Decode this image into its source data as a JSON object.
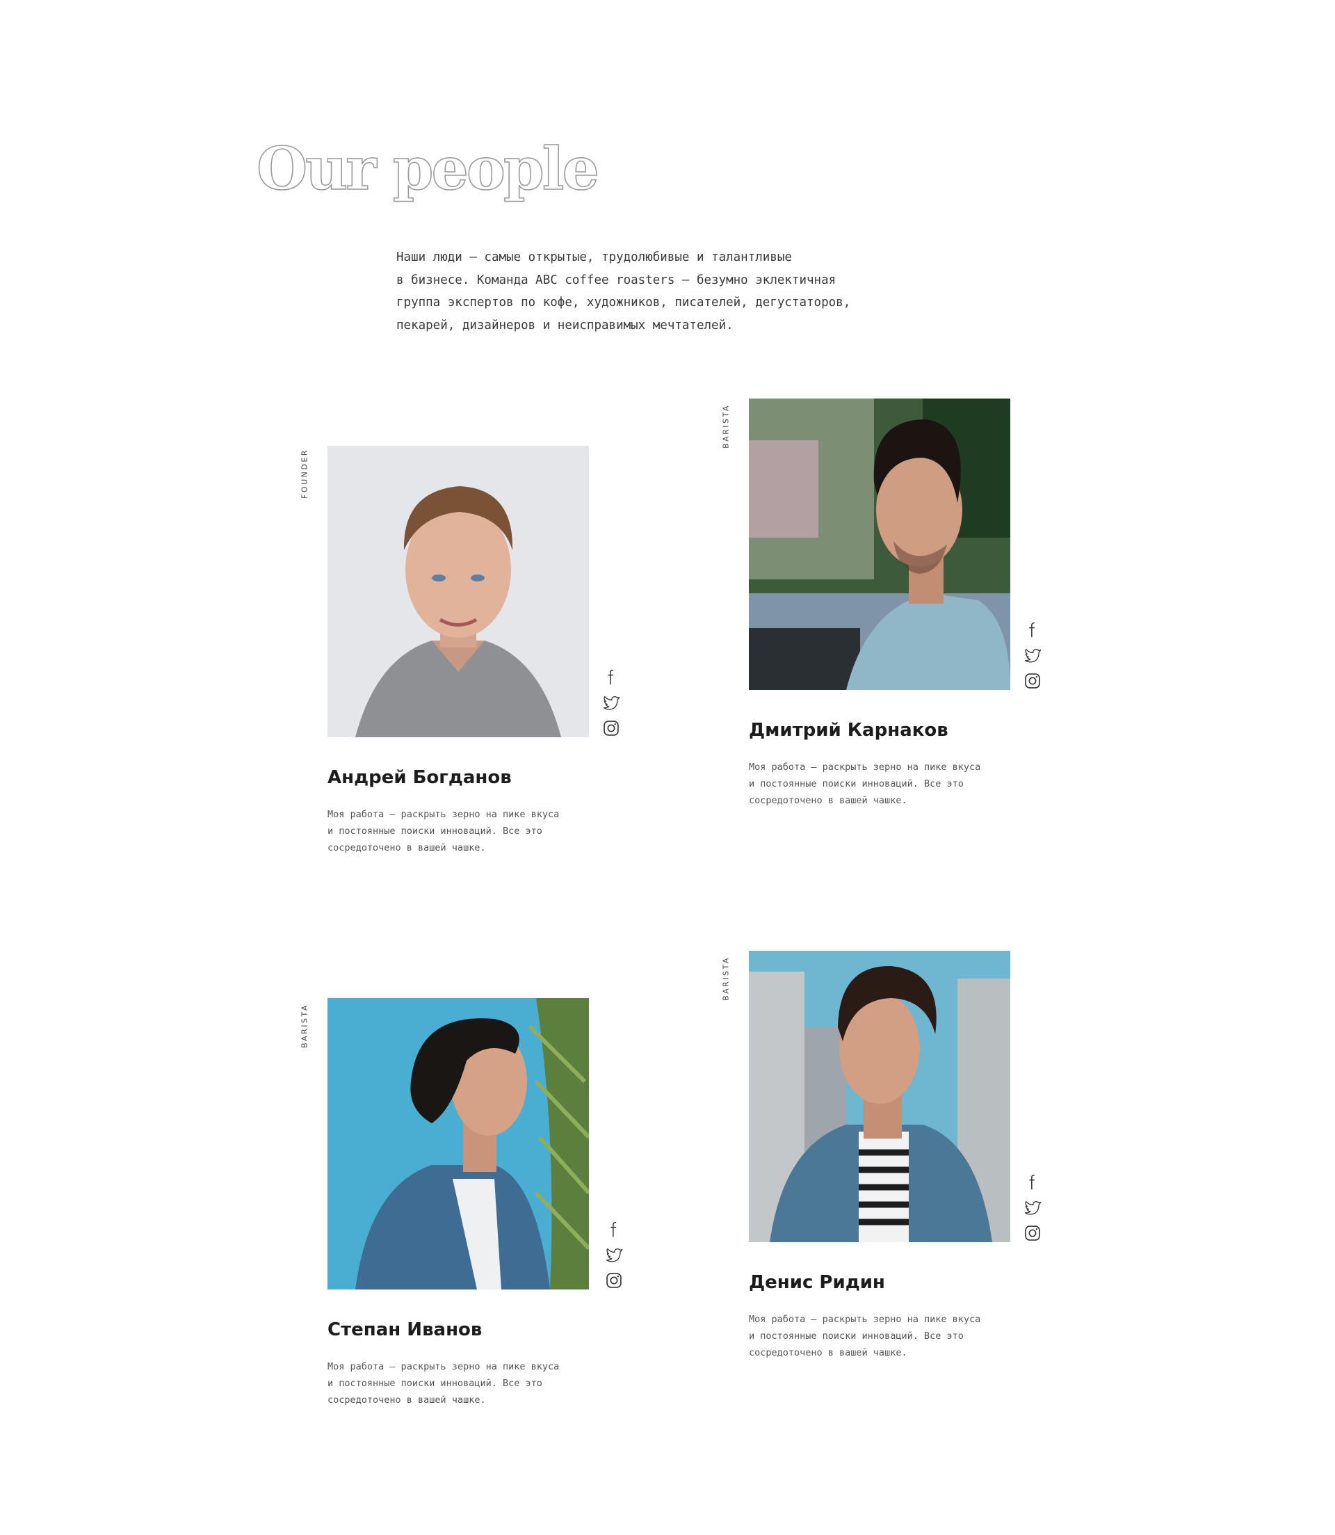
{
  "section": {
    "title": "Our people",
    "intro_lines": [
      "Наши люди — самые открытые, трудолюбивые и талантливые",
      "в бизнесе. Команда ABC coffee roasters — безумно эклектичная",
      "группа экспертов по кофе, художников, писателей, дегустаторов,",
      "пекарей, дизайнеров и неисправимых мечтателей."
    ]
  },
  "social_icons": [
    "facebook-icon",
    "twitter-icon",
    "instagram-icon"
  ],
  "team": [
    {
      "role": "FOUNDER",
      "name": "Андрей Богданов",
      "bio_lines": [
        "Моя работа — раскрыть зерно на пике вкуса",
        "и постоянные поиски инноваций. Все это",
        "сосредоточено в вашей чашке."
      ]
    },
    {
      "role": "BARISTA",
      "name": "Дмитрий Карнаков",
      "bio_lines": [
        "Моя работа — раскрыть зерно на пике вкуса",
        "и постоянные поиски инноваций. Все это",
        "сосредоточено в вашей чашке."
      ]
    },
    {
      "role": "BARISTA",
      "name": "Степан Иванов",
      "bio_lines": [
        "Моя работа — раскрыть зерно на пике вкуса",
        "и постоянные поиски инноваций. Все это",
        "сосредоточено в вашей чашке."
      ]
    },
    {
      "role": "BARISTA",
      "name": "Денис Ридин",
      "bio_lines": [
        "Моя работа — раскрыть зерно на пике вкуса",
        "и постоянные поиски инноваций. Все это",
        "сосредоточено в вашей чашке."
      ]
    }
  ]
}
